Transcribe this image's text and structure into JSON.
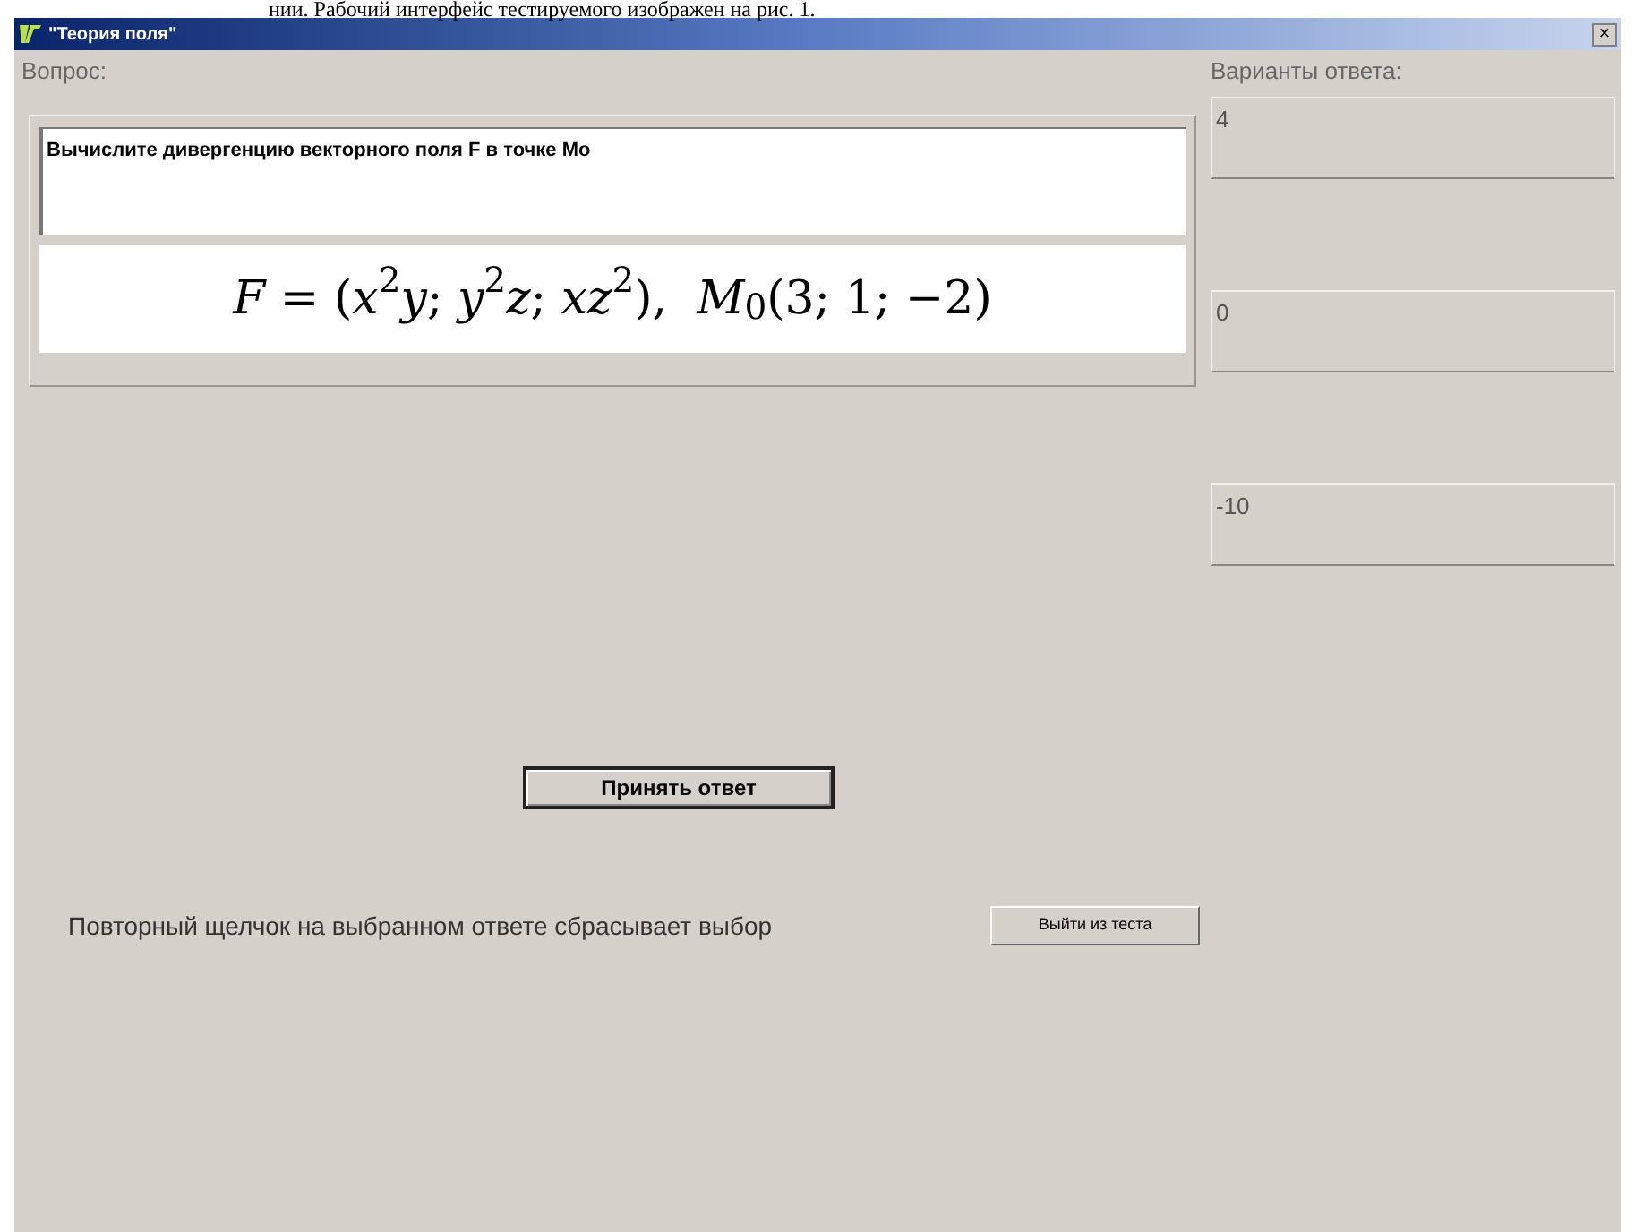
{
  "document_text": "нии. Рабочий интерфейс тестируемого изображен на рис. 1.",
  "window": {
    "title": "\"Теория поля\"",
    "close": "×"
  },
  "question": {
    "label": "Вопрос:",
    "text": "Вычислите дивергенцию векторного поля F в точке Mo",
    "formula": "*F* = (*x*$^{2}$*y*; *y*$^{2}$*z*; *xz*$^{2}$),  *M*$_{0}$(3; 1; −2)"
  },
  "answers": {
    "label": "Варианты ответа:",
    "options": [
      {
        "text": "4",
        "selected": false
      },
      {
        "text": "0",
        "selected": false
      },
      {
        "text": "-10",
        "selected": false
      }
    ]
  },
  "submit_button": "Принять ответ",
  "hint": "Повторный щелчок на выбранном ответе сбрасывает выбор",
  "exit_button": "Выйти из теста"
}
